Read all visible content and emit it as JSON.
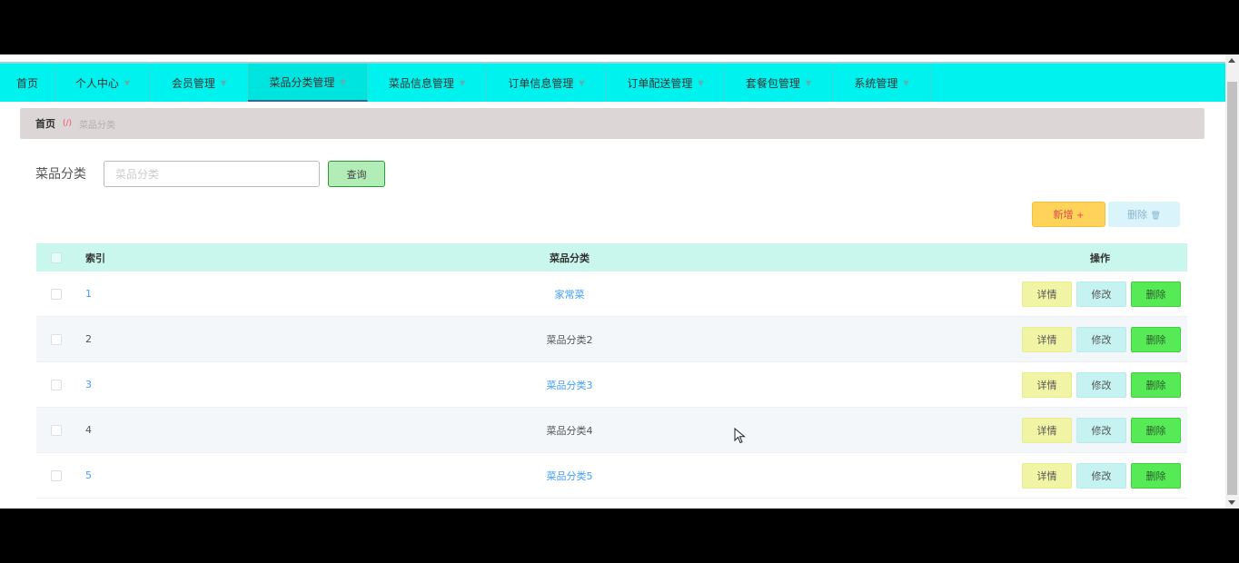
{
  "nav": {
    "items": [
      {
        "label": "首页",
        "has_caret": false
      },
      {
        "label": "个人中心",
        "has_caret": true
      },
      {
        "label": "会员管理",
        "has_caret": true
      },
      {
        "label": "菜品分类管理",
        "has_caret": true,
        "active": true
      },
      {
        "label": "菜品信息管理",
        "has_caret": true
      },
      {
        "label": "订单信息管理",
        "has_caret": true
      },
      {
        "label": "订单配送管理",
        "has_caret": true
      },
      {
        "label": "套餐包管理",
        "has_caret": true
      },
      {
        "label": "系统管理",
        "has_caret": true
      }
    ]
  },
  "breadcrumb": {
    "home": "首页",
    "separator": "(/)",
    "current": "菜品分类"
  },
  "search": {
    "label": "菜品分类",
    "placeholder": "菜品分类",
    "button": "查询"
  },
  "actions": {
    "add": "新增",
    "add_icon": "plus-icon",
    "delete": "删除",
    "delete_icon": "trash-icon"
  },
  "table": {
    "headers": {
      "index": "索引",
      "name": "菜品分类",
      "ops": "操作"
    },
    "rows": [
      {
        "index": "1",
        "name": "家常菜",
        "link": true
      },
      {
        "index": "2",
        "name": "菜品分类2",
        "link": false
      },
      {
        "index": "3",
        "name": "菜品分类3",
        "link": true
      },
      {
        "index": "4",
        "name": "菜品分类4",
        "link": false
      },
      {
        "index": "5",
        "name": "菜品分类5",
        "link": true
      }
    ],
    "row_buttons": {
      "detail": "详情",
      "edit": "修改",
      "delete": "删除"
    }
  },
  "colors": {
    "nav_bg": "#00f2ee",
    "header_bg": "#c9f7ee",
    "delete_green": "#57ea57",
    "add_yellow": "#ffd35a"
  }
}
